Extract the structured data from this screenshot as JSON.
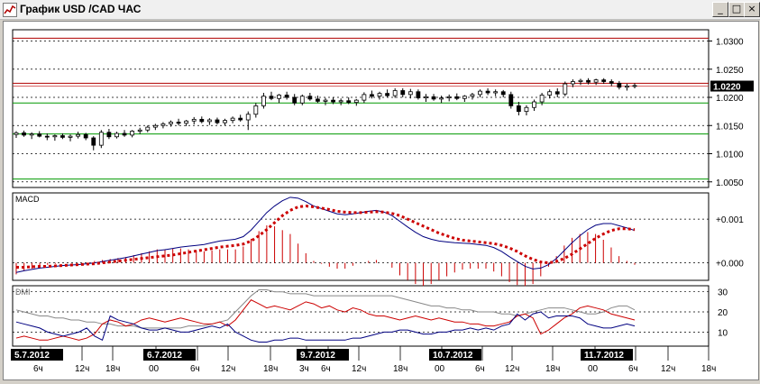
{
  "window": {
    "title": "График USD /CAD ЧАС",
    "icon": "chart-line-icon",
    "minimize_label": "_",
    "maximize_label": "□",
    "close_label": "×"
  },
  "colors": {
    "background": "#ffffff",
    "grid": "#000000",
    "resistance_line": "#b00000",
    "support_line": "#009900",
    "current_price_line": "#cc3333",
    "macd_line": "#000080",
    "signal_line": "#cc0000",
    "histogram": "#cc0000",
    "dmi_adx": "#888888",
    "dmi_plus": "#cc0000",
    "dmi_minus": "#000080",
    "date_badge_bg": "#000000",
    "date_badge_text": "#ffffff"
  },
  "chart_data": [
    {
      "type": "candlestick",
      "title": "",
      "y_ticks": [
        "1.0300",
        "1.0250",
        "1.0200",
        "1.0150",
        "1.0100",
        "1.0050"
      ],
      "ylim": [
        1.004,
        1.032
      ],
      "current_price": "1.0220",
      "horizontal_levels": [
        {
          "value": 1.0305,
          "color": "#b00000"
        },
        {
          "value": 1.0225,
          "color": "#b00000"
        },
        {
          "value": 1.019,
          "color": "#009900"
        },
        {
          "value": 1.0135,
          "color": "#009900"
        },
        {
          "value": 1.0055,
          "color": "#009900"
        }
      ],
      "candles": [
        [
          1.0134,
          1.014,
          1.0128,
          1.0137
        ],
        [
          1.0137,
          1.0141,
          1.013,
          1.0133
        ],
        [
          1.0133,
          1.0138,
          1.0126,
          1.0135
        ],
        [
          1.0135,
          1.014,
          1.0129,
          1.0131
        ],
        [
          1.0131,
          1.0136,
          1.0124,
          1.013
        ],
        [
          1.013,
          1.0134,
          1.0123,
          1.0132
        ],
        [
          1.0132,
          1.0136,
          1.0126,
          1.0129
        ],
        [
          1.0129,
          1.0134,
          1.0122,
          1.0131
        ],
        [
          1.0131,
          1.0139,
          1.0127,
          1.0134
        ],
        [
          1.0134,
          1.0137,
          1.0124,
          1.0128
        ],
        [
          1.0128,
          1.0131,
          1.0106,
          1.0115
        ],
        [
          1.0115,
          1.0142,
          1.011,
          1.0138
        ],
        [
          1.0138,
          1.0144,
          1.0126,
          1.013
        ],
        [
          1.013,
          1.0139,
          1.0127,
          1.0136
        ],
        [
          1.0136,
          1.0142,
          1.013,
          1.0133
        ],
        [
          1.0133,
          1.0142,
          1.0129,
          1.014
        ],
        [
          1.014,
          1.0146,
          1.0135,
          1.0142
        ],
        [
          1.0142,
          1.015,
          1.0138,
          1.0147
        ],
        [
          1.0147,
          1.0153,
          1.0142,
          1.015
        ],
        [
          1.015,
          1.0156,
          1.0145,
          1.0153
        ],
        [
          1.0153,
          1.0159,
          1.0148,
          1.0156
        ],
        [
          1.0156,
          1.0162,
          1.015,
          1.0154
        ],
        [
          1.0154,
          1.016,
          1.0149,
          1.0158
        ],
        [
          1.0158,
          1.0165,
          1.0152,
          1.0161
        ],
        [
          1.0161,
          1.0166,
          1.0154,
          1.0157
        ],
        [
          1.0157,
          1.0163,
          1.0151,
          1.016
        ],
        [
          1.016,
          1.0164,
          1.0152,
          1.0155
        ],
        [
          1.0155,
          1.0162,
          1.015,
          1.0159
        ],
        [
          1.0159,
          1.0166,
          1.0154,
          1.0163
        ],
        [
          1.0163,
          1.0169,
          1.0157,
          1.016
        ],
        [
          1.016,
          1.0175,
          1.0142,
          1.017
        ],
        [
          1.017,
          1.019,
          1.0164,
          1.0185
        ],
        [
          1.0185,
          1.0208,
          1.018,
          1.0202
        ],
        [
          1.0202,
          1.021,
          1.0195,
          1.0198
        ],
        [
          1.0198,
          1.0206,
          1.019,
          1.0204
        ],
        [
          1.0204,
          1.021,
          1.0196,
          1.02
        ],
        [
          1.02,
          1.0206,
          1.0186,
          1.019
        ],
        [
          1.019,
          1.0205,
          1.0186,
          1.0202
        ],
        [
          1.0202,
          1.0208,
          1.0194,
          1.0197
        ],
        [
          1.0197,
          1.0203,
          1.019,
          1.0193
        ],
        [
          1.0193,
          1.0199,
          1.0186,
          1.0195
        ],
        [
          1.0195,
          1.02,
          1.0188,
          1.0192
        ],
        [
          1.0192,
          1.0198,
          1.0186,
          1.0194
        ],
        [
          1.0194,
          1.02,
          1.0188,
          1.0191
        ],
        [
          1.0191,
          1.0197,
          1.0185,
          1.0195
        ],
        [
          1.0195,
          1.0209,
          1.019,
          1.0205
        ],
        [
          1.0205,
          1.0212,
          1.0198,
          1.0202
        ],
        [
          1.0202,
          1.021,
          1.0196,
          1.0207
        ],
        [
          1.0207,
          1.0214,
          1.02,
          1.0203
        ],
        [
          1.0203,
          1.0216,
          1.0199,
          1.0212
        ],
        [
          1.0212,
          1.0216,
          1.02,
          1.0205
        ],
        [
          1.0205,
          1.0215,
          1.0198,
          1.021
        ],
        [
          1.021,
          1.0214,
          1.0196,
          1.0199
        ],
        [
          1.0199,
          1.0206,
          1.0192,
          1.0201
        ],
        [
          1.0201,
          1.0206,
          1.0194,
          1.0197
        ],
        [
          1.0197,
          1.0203,
          1.019,
          1.0199
        ],
        [
          1.0199,
          1.0205,
          1.0193,
          1.0201
        ],
        [
          1.0201,
          1.0207,
          1.0195,
          1.0198
        ],
        [
          1.0198,
          1.0204,
          1.0192,
          1.0202
        ],
        [
          1.0202,
          1.0208,
          1.0196,
          1.0205
        ],
        [
          1.0205,
          1.0214,
          1.02,
          1.0211
        ],
        [
          1.0211,
          1.0216,
          1.0204,
          1.0208
        ],
        [
          1.0208,
          1.0214,
          1.0202,
          1.021
        ],
        [
          1.021,
          1.0213,
          1.02,
          1.0205
        ],
        [
          1.0205,
          1.021,
          1.018,
          1.0185
        ],
        [
          1.0185,
          1.0192,
          1.0168,
          1.0175
        ],
        [
          1.0175,
          1.0186,
          1.0168,
          1.0182
        ],
        [
          1.0182,
          1.0196,
          1.0176,
          1.0192
        ],
        [
          1.0192,
          1.0208,
          1.0186,
          1.0204
        ],
        [
          1.0204,
          1.0214,
          1.0198,
          1.021
        ],
        [
          1.021,
          1.0216,
          1.02,
          1.0206
        ],
        [
          1.0206,
          1.0228,
          1.0202,
          1.0224
        ],
        [
          1.0224,
          1.0232,
          1.0218,
          1.0228
        ],
        [
          1.0228,
          1.0233,
          1.0222,
          1.023
        ],
        [
          1.023,
          1.0234,
          1.0223,
          1.0227
        ],
        [
          1.0227,
          1.0233,
          1.0222,
          1.0231
        ],
        [
          1.0231,
          1.0234,
          1.0224,
          1.0228
        ],
        [
          1.0228,
          1.0232,
          1.022,
          1.0225
        ],
        [
          1.0225,
          1.0229,
          1.0214,
          1.0218
        ],
        [
          1.0218,
          1.0224,
          1.0212,
          1.022
        ],
        [
          1.022,
          1.0225,
          1.0216,
          1.0221
        ]
      ]
    },
    {
      "type": "line",
      "title": "MACD",
      "y_ticks": [
        "+0.001",
        "+0.000"
      ],
      "ylim": [
        -0.0004,
        0.0016
      ],
      "series": [
        {
          "values": [
            -0.00022,
            -0.00018,
            -0.00015,
            -0.00012,
            -0.0001,
            -8e-05,
            -6e-05,
            -5e-05,
            -4e-05,
            -2e-05,
            0.0,
            3e-05,
            6e-05,
            9e-05,
            0.00012,
            0.00016,
            0.0002,
            0.00024,
            0.00028,
            0.0003,
            0.00033,
            0.00036,
            0.00038,
            0.0004,
            0.00042,
            0.00046,
            0.0005,
            0.00052,
            0.00054,
            0.0006,
            0.00075,
            0.00095,
            0.00115,
            0.0013,
            0.00142,
            0.0015,
            0.00148,
            0.0014,
            0.0013,
            0.00124,
            0.00118,
            0.00112,
            0.0011,
            0.00112,
            0.00115,
            0.00118,
            0.0012,
            0.00116,
            0.00108,
            0.00095,
            0.00082,
            0.0007,
            0.0006,
            0.00054,
            0.0005,
            0.00048,
            0.00046,
            0.00045,
            0.00044,
            0.00042,
            0.0004,
            0.00035,
            0.00026,
            0.00014,
            3e-05,
            -8e-05,
            -0.00014,
            -0.00012,
            -4e-05,
            0.0001,
            0.00028,
            0.00046,
            0.00062,
            0.00076,
            0.00086,
            0.0009,
            0.0009,
            0.00085,
            0.0008,
            0.00074
          ]
        },
        {
          "values": [
            -0.0001,
            -0.0001,
            -9e-05,
            -8e-05,
            -8e-05,
            -7e-05,
            -6e-05,
            -5e-05,
            -4e-05,
            -3e-05,
            -2e-05,
            0.0,
            2e-05,
            4e-05,
            6e-05,
            8e-05,
            0.0001,
            0.00012,
            0.00014,
            0.00016,
            0.00018,
            0.00021,
            0.00024,
            0.00027,
            0.0003,
            0.00033,
            0.00036,
            0.00038,
            0.0004,
            0.00043,
            0.0005,
            0.00062,
            0.00076,
            0.00092,
            0.00108,
            0.0012,
            0.00128,
            0.0013,
            0.00128,
            0.00125,
            0.00122,
            0.00118,
            0.00116,
            0.00115,
            0.00115,
            0.00116,
            0.00117,
            0.00116,
            0.00113,
            0.00108,
            0.001,
            0.00092,
            0.00084,
            0.00076,
            0.00068,
            0.00062,
            0.00056,
            0.00052,
            0.0005,
            0.00048,
            0.00046,
            0.00044,
            0.0004,
            0.00034,
            0.00026,
            0.00016,
            8e-05,
            2e-05,
            0.0,
            3e-05,
            0.0001,
            0.0002,
            0.00032,
            0.00044,
            0.00056,
            0.00066,
            0.00074,
            0.00078,
            0.00078,
            0.00076
          ]
        }
      ]
    },
    {
      "type": "line",
      "title": "DMI",
      "y_ticks": [
        "30",
        "20",
        "10"
      ],
      "ylim": [
        3,
        33
      ],
      "series": [
        {
          "values": [
            21,
            20,
            19,
            18,
            18,
            17,
            17,
            16,
            16,
            15,
            15,
            14,
            14,
            13,
            13,
            13,
            12,
            12,
            12,
            12,
            12,
            12,
            13,
            13,
            13,
            14,
            15,
            16,
            20,
            24,
            28,
            31,
            31,
            30,
            30,
            29,
            29,
            29,
            28,
            28,
            28,
            28,
            28,
            28,
            28,
            28,
            28,
            28,
            28,
            27,
            26,
            25,
            24,
            23,
            23,
            22,
            22,
            21,
            21,
            20,
            20,
            20,
            19,
            19,
            18,
            19,
            20,
            21,
            22,
            22,
            22,
            21,
            20,
            19,
            19,
            20,
            22,
            23,
            23,
            21
          ]
        },
        {
          "values": [
            7,
            8,
            7,
            6,
            6,
            7,
            8,
            7,
            6,
            7,
            9,
            14,
            16,
            15,
            13,
            14,
            16,
            17,
            16,
            15,
            16,
            17,
            16,
            15,
            14,
            14,
            15,
            13,
            16,
            21,
            26,
            24,
            22,
            23,
            22,
            21,
            23,
            25,
            24,
            22,
            23,
            21,
            20,
            22,
            21,
            19,
            18,
            18,
            17,
            16,
            17,
            18,
            17,
            16,
            17,
            16,
            15,
            15,
            14,
            14,
            13,
            13,
            14,
            15,
            18,
            19,
            17,
            9,
            11,
            14,
            17,
            19,
            22,
            23,
            22,
            21,
            19,
            18,
            17,
            16
          ]
        },
        {
          "values": [
            15,
            14,
            13,
            12,
            10,
            9,
            8,
            9,
            10,
            12,
            8,
            6,
            18,
            16,
            15,
            14,
            12,
            11,
            11,
            12,
            11,
            10,
            10,
            11,
            12,
            13,
            12,
            14,
            10,
            8,
            6,
            5,
            5,
            6,
            6,
            7,
            7,
            6,
            6,
            6,
            6,
            6,
            6,
            7,
            7,
            8,
            9,
            10,
            10,
            11,
            11,
            10,
            9,
            9,
            10,
            10,
            11,
            11,
            12,
            11,
            12,
            11,
            13,
            14,
            19,
            16,
            19,
            20,
            17,
            18,
            18,
            18,
            17,
            14,
            13,
            12,
            12,
            13,
            14,
            13
          ]
        }
      ]
    }
  ],
  "time_axis": {
    "ticks": [
      "6ч",
      "12ч",
      "18ч",
      "00",
      "6ч",
      "12ч",
      "18ч",
      "3ч",
      "6ч",
      "12ч",
      "18ч",
      "00",
      "6ч",
      "12ч",
      "18ч",
      "00",
      "6ч",
      "12ч",
      "18ч"
    ],
    "dates": [
      "5.7.2012",
      "6.7.2012",
      "9.7.2012",
      "10.7.2012",
      "11.7.2012"
    ]
  }
}
